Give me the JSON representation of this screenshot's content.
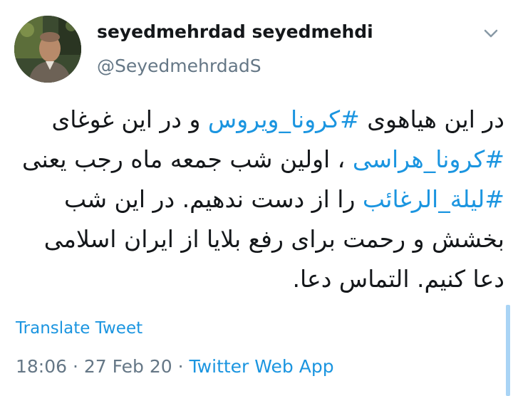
{
  "tweet": {
    "author": {
      "display_name": "seyedmehrdad seyedmehdi",
      "handle": "@SeyedmehrdadS"
    },
    "menu_icon": "chevron-down-icon",
    "text_segments": [
      {
        "text": "در این هیاهوی ",
        "type": "text"
      },
      {
        "text": "#کرونا_ویروس",
        "type": "hashtag"
      },
      {
        "text": "  و در این غوغای ",
        "type": "text"
      },
      {
        "text": "#کرونا_هراسی",
        "type": "hashtag"
      },
      {
        "text": " ، اولین شب جمعه ماه رجب یعنی ",
        "type": "text"
      },
      {
        "text": "#لیلة_الرغائب",
        "type": "hashtag"
      },
      {
        "text": " را از دست ندهیم. در این شب بخشش و رحمت برای رفع بلایا از ایران اسلامی دعا کنیم. التماس دعا.",
        "type": "text"
      }
    ],
    "translate_label": "Translate Tweet",
    "time": "18:06",
    "separator": "·",
    "date": "27 Feb 20",
    "source": "Twitter Web App"
  },
  "colors": {
    "link": "#1b95e0",
    "secondary_text": "#657786",
    "primary_text": "#14171a"
  }
}
